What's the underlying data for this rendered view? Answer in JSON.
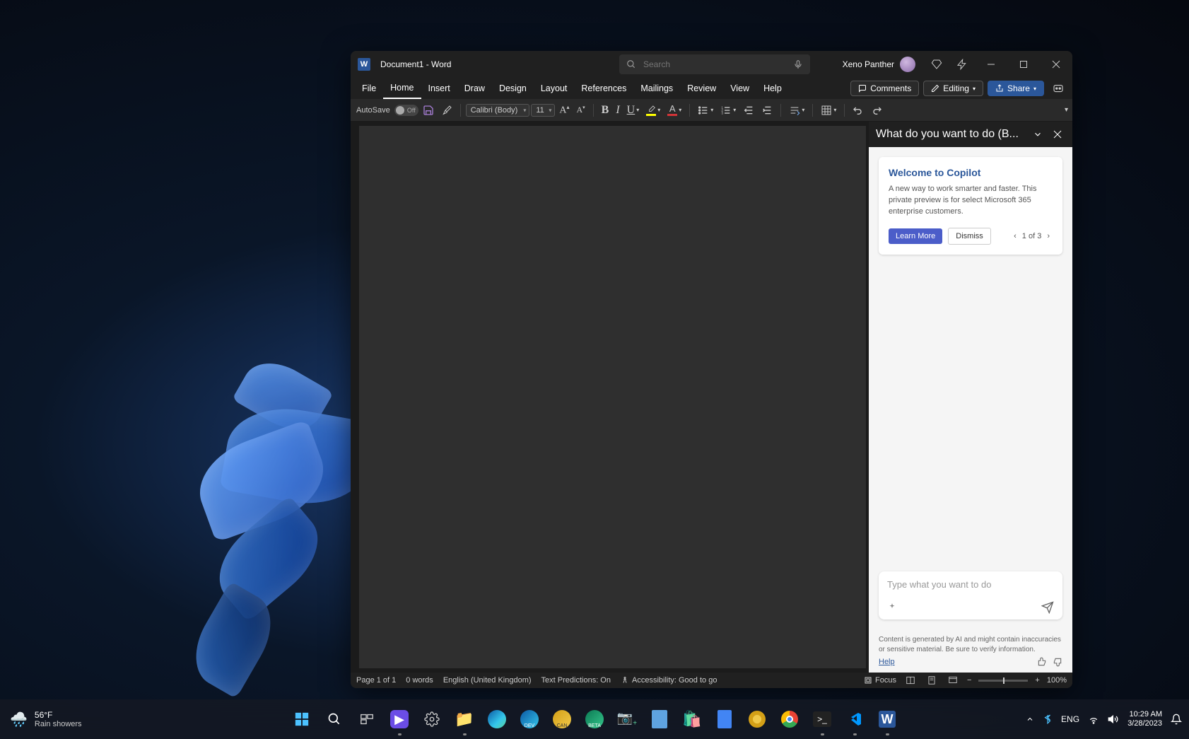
{
  "titlebar": {
    "doc_title": "Document1  -  Word",
    "search_placeholder": "Search",
    "user_name": "Xeno Panther"
  },
  "ribbon": {
    "tabs": [
      "File",
      "Home",
      "Insert",
      "Draw",
      "Design",
      "Layout",
      "References",
      "Mailings",
      "Review",
      "View",
      "Help"
    ],
    "active_index": 1,
    "comments_label": "Comments",
    "editing_label": "Editing",
    "share_label": "Share"
  },
  "toolbar": {
    "autosave_label": "AutoSave",
    "autosave_state": "Off",
    "font_name": "Calibri (Body)",
    "font_size": "11"
  },
  "copilot": {
    "panel_title": "What do you want to do (B...",
    "card_title": "Welcome to Copilot",
    "card_text": "A new way to work smarter and faster. This private preview is for select Microsoft 365 enterprise customers.",
    "learn_more": "Learn More",
    "dismiss": "Dismiss",
    "pager_text": "1 of 3",
    "input_placeholder": "Type what you want to do",
    "disclaimer": "Content is generated by AI and might contain inaccuracies or sensitive material. Be sure to verify information.",
    "help": "Help"
  },
  "statusbar": {
    "page_info": "Page 1 of 1",
    "words": "0 words",
    "language": "English (United Kingdom)",
    "predictions": "Text Predictions: On",
    "accessibility": "Accessibility: Good to go",
    "focus": "Focus",
    "zoom": "100%"
  },
  "taskbar": {
    "weather_temp": "56°F",
    "weather_desc": "Rain showers",
    "lang": "ENG",
    "time": "10:29 AM",
    "date": "3/28/2023"
  }
}
